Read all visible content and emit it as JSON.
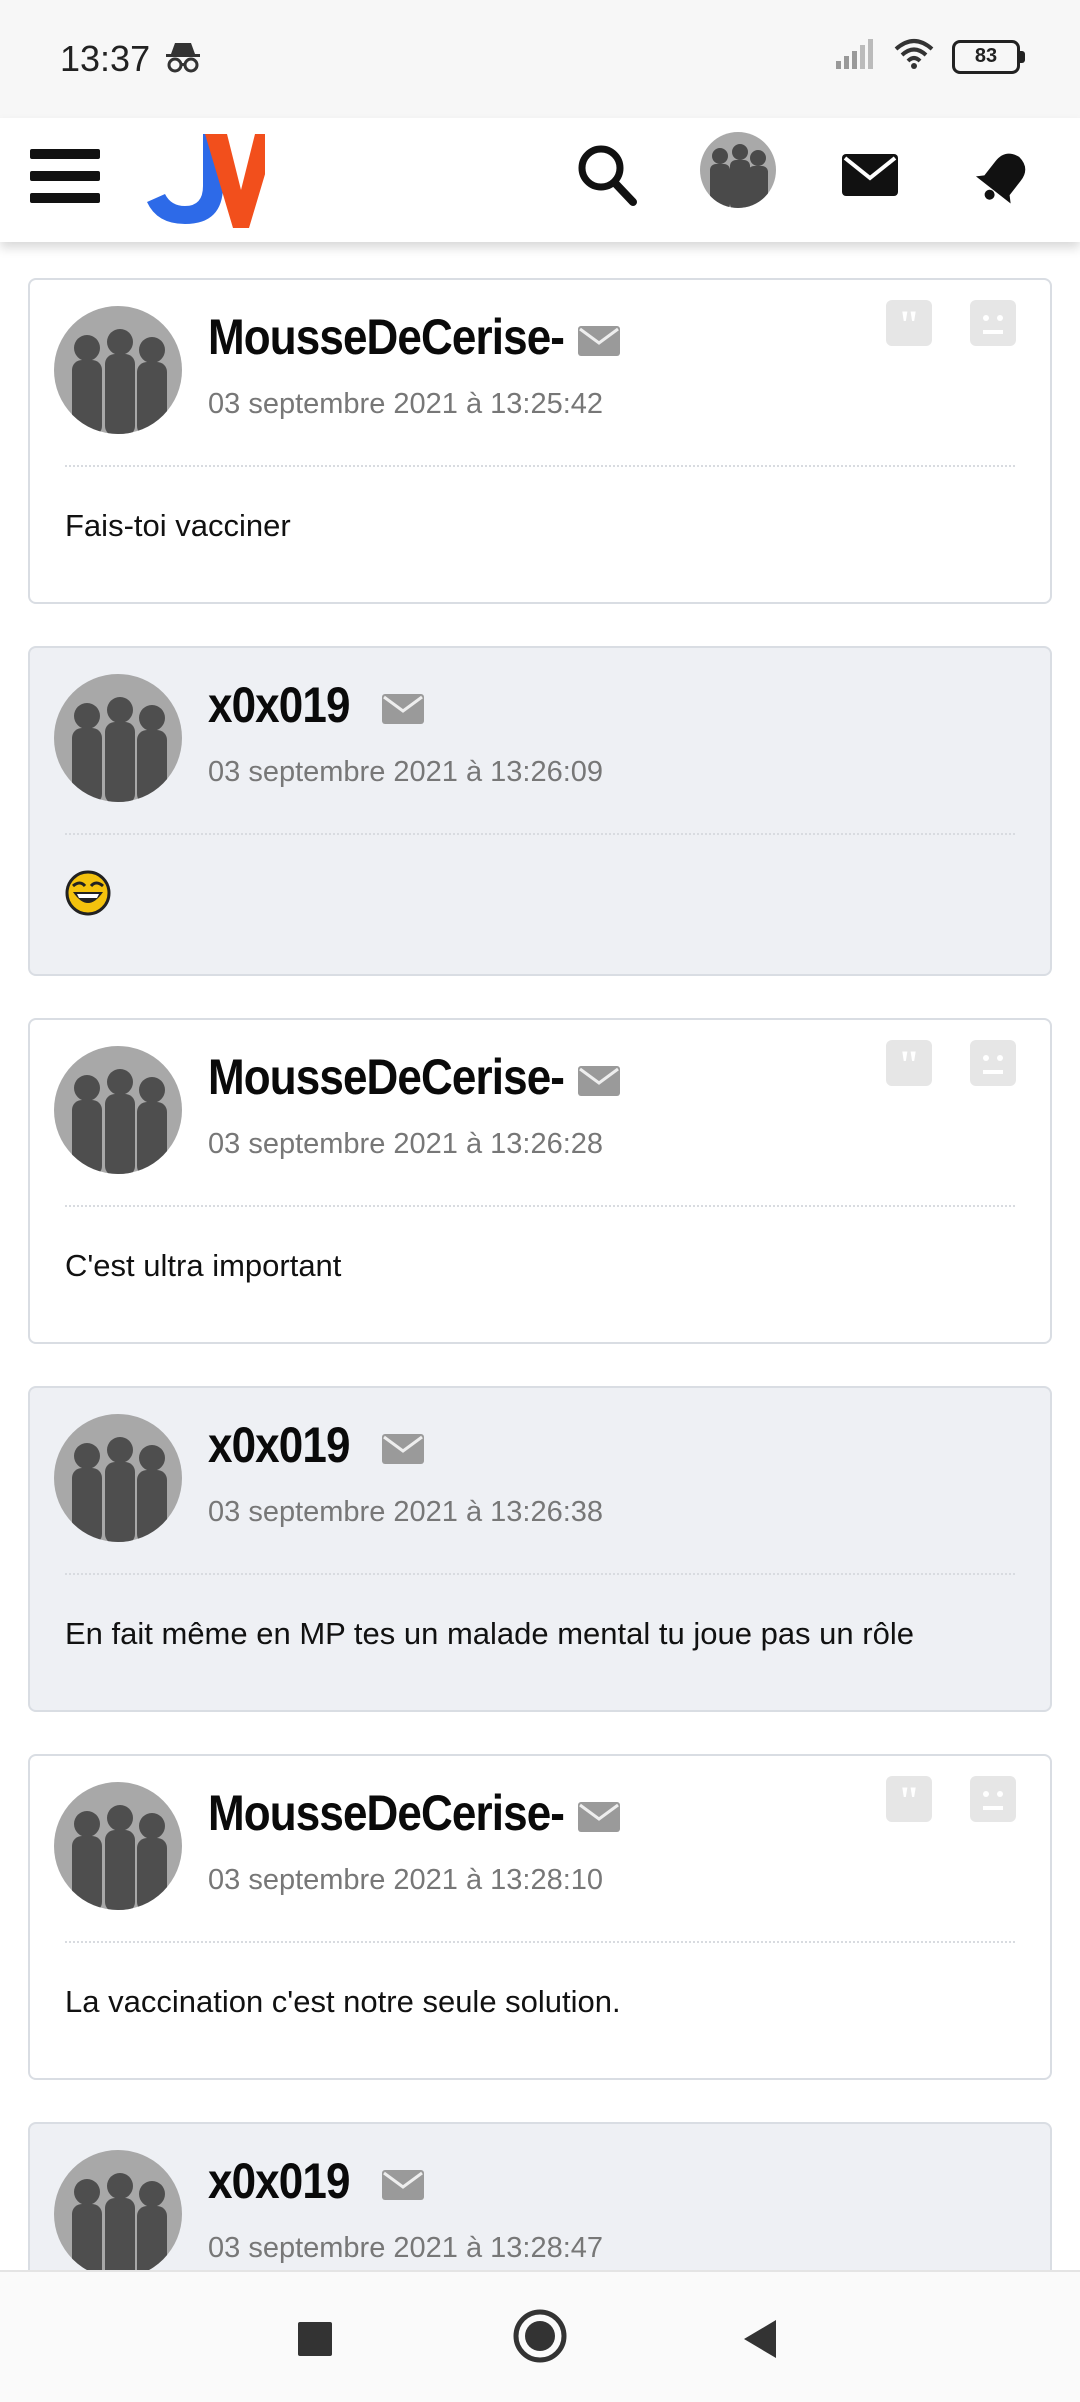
{
  "status_bar": {
    "time": "13:37",
    "battery": "83",
    "icons": [
      "incognito-icon",
      "signal-icon",
      "wifi-icon",
      "battery-icon"
    ]
  },
  "header": {
    "logo_text": "JV",
    "logo_colors": {
      "j": "#2d6ae8",
      "v": "#f24f1c"
    },
    "icons": [
      "menu-icon",
      "search-icon",
      "avatar",
      "mail-icon",
      "bell-icon"
    ]
  },
  "posts": [
    {
      "author": "MousseDeCerise-",
      "date": "03 septembre 2021 à 13:25:42",
      "message": "Fais-toi vacciner",
      "own": true
    },
    {
      "author": "x0x019",
      "date": "03 septembre 2021 à 13:26:09",
      "message": "",
      "emoji": "laughing-emoji",
      "own": false
    },
    {
      "author": "MousseDeCerise-",
      "date": "03 septembre 2021 à 13:26:28",
      "message": "C'est ultra important",
      "own": true
    },
    {
      "author": "x0x019",
      "date": "03 septembre 2021 à 13:26:38",
      "message": "En fait même en MP tes un malade mental tu joue pas un rôle",
      "own": false
    },
    {
      "author": "MousseDeCerise-",
      "date": "03 septembre 2021 à 13:28:10",
      "message": "La vaccination c'est notre seule solution.",
      "own": true
    },
    {
      "author": "x0x019",
      "date": "03 septembre 2021 à 13:28:47",
      "message": "",
      "own": false
    }
  ],
  "nav": [
    "recents-button",
    "home-button",
    "back-button"
  ]
}
